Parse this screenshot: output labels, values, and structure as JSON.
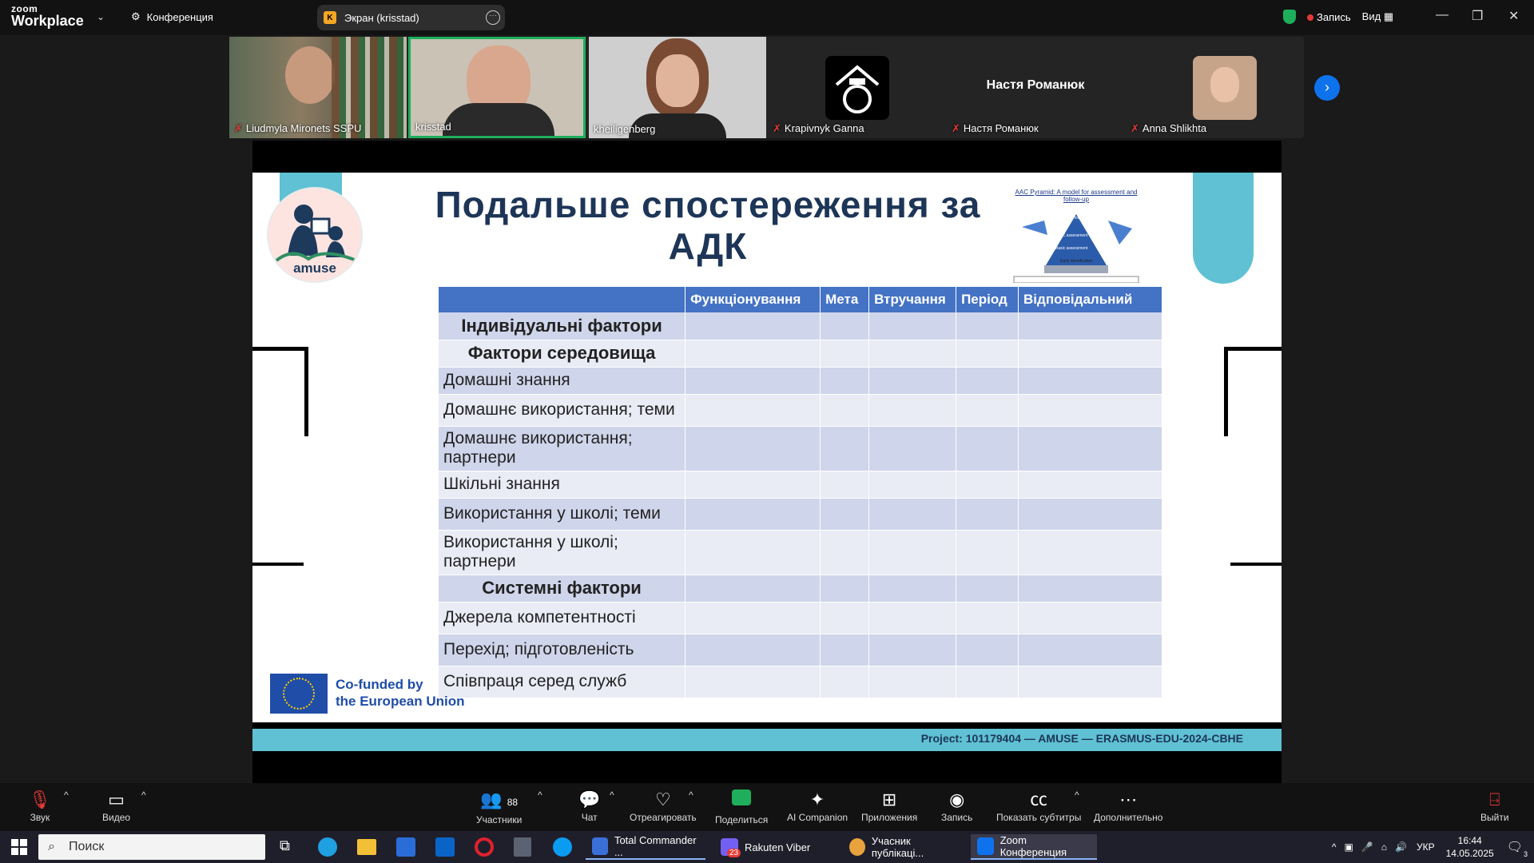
{
  "app": {
    "logo_top": "zoom",
    "logo_bottom": "Workplace",
    "meeting_label": "Конференция"
  },
  "screen_share": {
    "label": "Экран (krisstad)",
    "initial": "K"
  },
  "top_right": {
    "record": "Запись",
    "view": "Вид"
  },
  "participants": [
    {
      "name": "Liudmyla Mironets SSPU"
    },
    {
      "name": "krisstad"
    },
    {
      "name": "kheiligenberg"
    },
    {
      "name": "Krapivnyk Ganna"
    },
    {
      "name": "Настя Романюк",
      "center_label": "Настя Романюк"
    },
    {
      "name": "Anna Shlikhta"
    }
  ],
  "slide": {
    "title_line1": "Подальше спостереження за",
    "title_line2": "АДК",
    "logo_text": "amuse",
    "thumb_title": "AAC Pyramid: A model for assessment and follow-up",
    "thumb_levels": [
      "AAC follow-up",
      "AAC assessment",
      "Basic assessment",
      "Early identification"
    ],
    "headers": [
      "",
      "Функціонування",
      "Мета",
      "Втручання",
      "Період",
      "Відповідальний"
    ],
    "rows": [
      {
        "label": "Індивідуальні фактори",
        "bold": true
      },
      {
        "label": "Фактори середовища",
        "bold": true
      },
      {
        "label": "Домашні знання",
        "bold": false
      },
      {
        "label": "Домашнє використання; теми",
        "bold": false
      },
      {
        "label": "Домашнє використання; партнери",
        "bold": false
      },
      {
        "label": "Шкільні знання",
        "bold": false
      },
      {
        "label": "Використання у школі; теми",
        "bold": false
      },
      {
        "label": "Використання у школі; партнери",
        "bold": false
      },
      {
        "label": "Системні фактори",
        "bold": true
      },
      {
        "label": "Джерела компетентності",
        "bold": false
      },
      {
        "label": "Перехід; підготовленість",
        "bold": false
      },
      {
        "label": "Співпраця серед служб",
        "bold": false
      }
    ],
    "eu_line1": "Co-funded by",
    "eu_line2": "the European Union",
    "footer": "Project: 101179404 — AMUSE — ERASMUS-EDU-2024-CBHE"
  },
  "toolbar": {
    "audio": "Звук",
    "video": "Видео",
    "participants": "Участники",
    "participants_count": "88",
    "chat": "Чат",
    "react": "Отреагировать",
    "share": "Поделиться",
    "ai": "AI Companion",
    "apps": "Приложения",
    "record": "Запись",
    "captions": "Показать субтитры",
    "more": "Дополнительно",
    "leave": "Выйти"
  },
  "taskbar": {
    "search_placeholder": "Поиск",
    "apps": [
      {
        "label": "Total Commander ...",
        "color": "#3b6fd8"
      },
      {
        "label": "Rakuten Viber",
        "color": "#7360f2",
        "badge": "23"
      },
      {
        "label": "Учасник публікаці...",
        "color": "#e8a33d"
      },
      {
        "label": "Zoom Конференция",
        "color": "#0e72ed"
      }
    ],
    "lang": "УКР",
    "time": "16:44",
    "date": "14.05.2025",
    "notifications": "3"
  },
  "colors": {
    "accent": "#0e72ed",
    "slide_header": "#4472c4",
    "teal": "#5fc1d3",
    "title": "#1d3557"
  }
}
